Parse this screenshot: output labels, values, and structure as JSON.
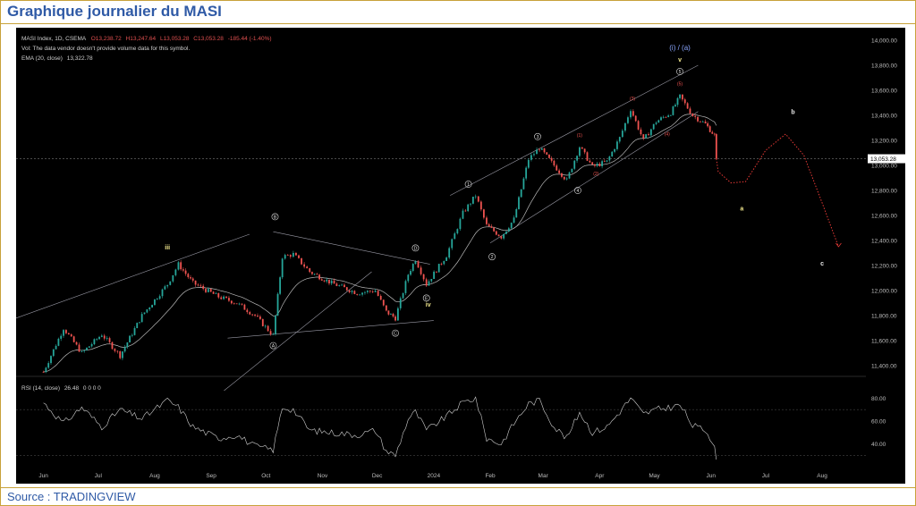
{
  "page": {
    "title": "Graphique journalier du MASI",
    "source": "Source : TRADINGVIEW"
  },
  "chart_data": {
    "type": "candlestick",
    "info": {
      "symbol_line": "MASI Index, 1D, CSEMA",
      "ohlc": {
        "O": "13,238.72",
        "H": "13,247.64",
        "L": "13,053.28",
        "C": "13,053.28",
        "change": "-185.44 (-1.40%)"
      },
      "vol_note": "Vol: The data vendor doesn't provide volume data for this symbol.",
      "ema_label": "EMA (20, close)",
      "ema_value": "13,322.78"
    },
    "y_ticks": [
      "11,400.00",
      "11,600.00",
      "11,800.00",
      "12,000.00",
      "12,200.00",
      "12,400.00",
      "12,600.00",
      "12,800.00",
      "13,000.00",
      "13,200.00",
      "13,400.00",
      "13,600.00",
      "13,800.00",
      "14,000.00"
    ],
    "last_price": "13,053.28",
    "x_months": [
      "Jun",
      "Jul",
      "Aug",
      "Sep",
      "Oct",
      "Nov",
      "Dec",
      "2024",
      "Feb",
      "Mar",
      "Apr",
      "May",
      "Jun",
      "Jul",
      "Aug"
    ],
    "anchors": [
      [
        "2023-06-01",
        11350
      ],
      [
        "2023-06-12",
        11700
      ],
      [
        "2023-06-22",
        11500
      ],
      [
        "2023-07-03",
        11650
      ],
      [
        "2023-07-13",
        11480
      ],
      [
        "2023-07-25",
        11800
      ],
      [
        "2023-08-08",
        12050
      ],
      [
        "2023-08-14",
        12210
      ],
      [
        "2023-08-22",
        12060
      ],
      [
        "2023-09-05",
        11950
      ],
      [
        "2023-09-15",
        11900
      ],
      [
        "2023-09-25",
        11800
      ],
      [
        "2023-10-05",
        11640
      ],
      [
        "2023-10-10",
        12270
      ],
      [
        "2023-10-16",
        12290
      ],
      [
        "2023-10-25",
        12150
      ],
      [
        "2023-11-06",
        12060
      ],
      [
        "2023-11-20",
        11980
      ],
      [
        "2023-11-30",
        12000
      ],
      [
        "2023-12-06",
        11830
      ],
      [
        "2023-12-11",
        11780
      ],
      [
        "2023-12-18",
        12130
      ],
      [
        "2023-12-22",
        12250
      ],
      [
        "2023-12-28",
        12050
      ],
      [
        "2024-01-08",
        12280
      ],
      [
        "2024-01-17",
        12620
      ],
      [
        "2024-01-24",
        12760
      ],
      [
        "2024-01-30",
        12520
      ],
      [
        "2024-02-07",
        12430
      ],
      [
        "2024-02-14",
        12570
      ],
      [
        "2024-02-22",
        13050
      ],
      [
        "2024-02-28",
        13140
      ],
      [
        "2024-03-07",
        13000
      ],
      [
        "2024-03-14",
        12880
      ],
      [
        "2024-03-21",
        13150
      ],
      [
        "2024-03-28",
        12990
      ],
      [
        "2024-04-05",
        13030
      ],
      [
        "2024-04-12",
        13220
      ],
      [
        "2024-04-18",
        13450
      ],
      [
        "2024-04-25",
        13200
      ],
      [
        "2024-05-02",
        13350
      ],
      [
        "2024-05-10",
        13420
      ],
      [
        "2024-05-15",
        13550
      ],
      [
        "2024-05-22",
        13400
      ],
      [
        "2024-05-29",
        13330
      ],
      [
        "2024-06-03",
        13240
      ],
      [
        "2024-06-04",
        13053
      ]
    ],
    "wave_labels": {
      "upper_degree": "(i) / (a)",
      "roman": [
        "iii",
        "iv",
        "v"
      ],
      "abc": [
        "a",
        "b",
        "c"
      ],
      "circled_letters": [
        "A",
        "B",
        "C",
        "D",
        "E"
      ],
      "circled_numbers": [
        "1",
        "2",
        "3",
        "4",
        "5"
      ],
      "minor": [
        "(1)",
        "(2)",
        "(3)",
        "(4)",
        "(5)"
      ]
    },
    "rsi": {
      "label": "RSI (14, close)",
      "value": "26.48",
      "extra": "0 0 0 0",
      "ticks": [
        "40.00",
        "60.00",
        "80.00"
      ],
      "anchors": [
        [
          "2023-06-01",
          76
        ],
        [
          "2023-06-12",
          58
        ],
        [
          "2023-06-22",
          72
        ],
        [
          "2023-07-03",
          55
        ],
        [
          "2023-07-13",
          70
        ],
        [
          "2023-07-25",
          62
        ],
        [
          "2023-08-08",
          78
        ],
        [
          "2023-08-14",
          72
        ],
        [
          "2023-08-22",
          55
        ],
        [
          "2023-09-05",
          45
        ],
        [
          "2023-09-15",
          48
        ],
        [
          "2023-09-25",
          38
        ],
        [
          "2023-10-05",
          35
        ],
        [
          "2023-10-10",
          72
        ],
        [
          "2023-10-16",
          70
        ],
        [
          "2023-10-25",
          52
        ],
        [
          "2023-11-06",
          50
        ],
        [
          "2023-11-20",
          48
        ],
        [
          "2023-11-30",
          52
        ],
        [
          "2023-12-06",
          34
        ],
        [
          "2023-12-11",
          30
        ],
        [
          "2023-12-18",
          62
        ],
        [
          "2023-12-22",
          68
        ],
        [
          "2023-12-28",
          52
        ],
        [
          "2024-01-08",
          64
        ],
        [
          "2024-01-17",
          76
        ],
        [
          "2024-01-24",
          80
        ],
        [
          "2024-01-30",
          45
        ],
        [
          "2024-02-07",
          40
        ],
        [
          "2024-02-14",
          58
        ],
        [
          "2024-02-22",
          75
        ],
        [
          "2024-02-28",
          78
        ],
        [
          "2024-03-07",
          55
        ],
        [
          "2024-03-14",
          45
        ],
        [
          "2024-03-21",
          68
        ],
        [
          "2024-03-28",
          50
        ],
        [
          "2024-04-05",
          55
        ],
        [
          "2024-04-12",
          68
        ],
        [
          "2024-04-18",
          80
        ],
        [
          "2024-04-25",
          66
        ],
        [
          "2024-05-02",
          70
        ],
        [
          "2024-05-10",
          72
        ],
        [
          "2024-05-15",
          74
        ],
        [
          "2024-05-22",
          56
        ],
        [
          "2024-05-29",
          52
        ],
        [
          "2024-06-03",
          40
        ],
        [
          "2024-06-04",
          26.48
        ]
      ]
    },
    "projection": [
      [
        "2024-06-05",
        12950
      ],
      [
        "2024-06-12",
        12860
      ],
      [
        "2024-06-20",
        12870
      ],
      [
        "2024-07-01",
        13120
      ],
      [
        "2024-07-12",
        13250
      ],
      [
        "2024-07-22",
        13080
      ],
      [
        "2024-08-01",
        12700
      ],
      [
        "2024-08-10",
        12350
      ]
    ],
    "colors": {
      "up": "#26a69a",
      "down": "#ef5350",
      "ema": "#b8b8b8",
      "rsi": "#d0d0d0",
      "projection": "#e53935",
      "label": "#d8d8d8",
      "roman": "#f0e68c"
    }
  }
}
